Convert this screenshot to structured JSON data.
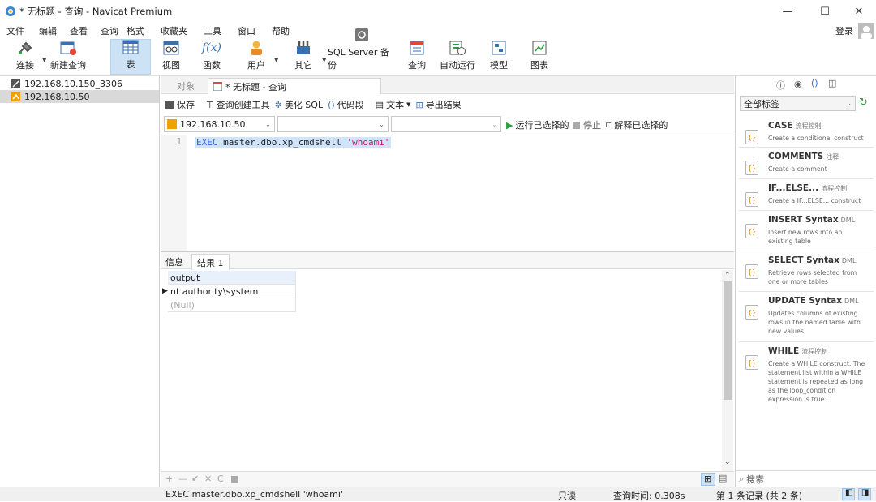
{
  "window": {
    "title": "* 无标题 - 查询 - Navicat Premium",
    "minimize": "—",
    "maximize": "☐",
    "close": "✕"
  },
  "menu": [
    "文件",
    "编辑",
    "查看",
    "查询",
    "格式",
    "收藏夹",
    "工具",
    "窗口",
    "帮助"
  ],
  "login_label": "登录",
  "toolbar": {
    "connect": "连接",
    "new_query": "新建查询",
    "table": "表",
    "view": "视图",
    "function": "函数",
    "user": "用户",
    "other": "其它",
    "backup": "SQL Server 备份",
    "query": "查询",
    "automation": "自动运行",
    "model": "模型",
    "chart": "图表"
  },
  "connections": [
    "192.168.10.150_3306",
    "192.168.10.50"
  ],
  "tabs": {
    "objects": "对象",
    "query": "* 无标题 - 查询"
  },
  "query_toolbar": {
    "save": "保存",
    "builder": "查询创建工具",
    "beautify": "美化 SQL",
    "snippet": "代码段",
    "text": "文本",
    "export": "导出结果",
    "run": "运行已选择的",
    "stop": "停止",
    "explain": "解释已选择的"
  },
  "selectors": {
    "connection": "192.168.10.50",
    "database": "",
    "schema": ""
  },
  "editor": {
    "line_number": "1",
    "kw": "EXEC",
    "body": " master.dbo.xp_cmdshell ",
    "str": "'whoami'"
  },
  "results": {
    "tab_info": "信息",
    "tab_result": "结果 1",
    "column": "output",
    "rows": [
      "nt authority\\system",
      "(Null)"
    ],
    "bottom_buttons": [
      "+",
      "—",
      "✔",
      "✕",
      "C",
      "■"
    ]
  },
  "snippets_panel": {
    "filter": "全部标签",
    "search_placeholder": "搜索",
    "items": [
      {
        "name": "CASE",
        "tag": "流程控制",
        "desc": "Create a conditional construct"
      },
      {
        "name": "COMMENTS",
        "tag": "注释",
        "desc": "Create a comment"
      },
      {
        "name": "IF...ELSE...",
        "tag": "流程控制",
        "desc": "Create a IF...ELSE... construct"
      },
      {
        "name": "INSERT Syntax",
        "tag": "DML",
        "desc": "Insert new rows into an existing table"
      },
      {
        "name": "SELECT Syntax",
        "tag": "DML",
        "desc": "Retrieve rows selected from one or more tables"
      },
      {
        "name": "UPDATE Syntax",
        "tag": "DML",
        "desc": "Updates columns of existing rows in the named table with new values"
      },
      {
        "name": "WHILE",
        "tag": "流程控制",
        "desc": "Create a WHILE construct. The statement list within a WHILE statement is repeated as long as the loop_condition expression is true."
      }
    ]
  },
  "status": {
    "sql": "EXEC master.dbo.xp_cmdshell 'whoami'",
    "readonly": "只读",
    "time": "查询时间: 0.308s",
    "record": "第 1 条记录 (共 2 条)"
  },
  "colors": {
    "accent": "#2f6fd6",
    "keyword": "#3b5bdb",
    "string": "#c2185b",
    "active_tool": "#cde3f5",
    "selection": "#cfe3fb"
  }
}
